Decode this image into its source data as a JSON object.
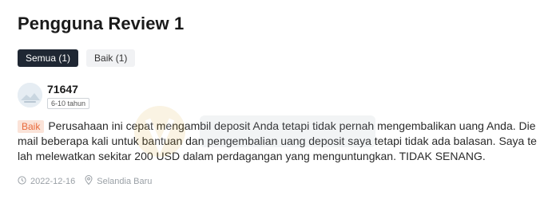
{
  "header": {
    "title": "Pengguna Review 1"
  },
  "tabs": [
    {
      "label": "Semua (1)",
      "active": true
    },
    {
      "label": "Baik (1)",
      "active": false
    }
  ],
  "review": {
    "user": {
      "name": "71647",
      "badge": "6-10 tahun",
      "avatar_icon": "user-avatar-icon"
    },
    "rating_label": "Baik",
    "text": "Perusahaan ini cepat mengambil deposit Anda tetapi tidak pernah mengembalikan uang Anda. Die mail beberapa kali untuk bantuan dan pengembalian uang deposit saya tetapi tidak ada balasan. Saya telah melewatkan sekitar 200 USD dalam perdagangan yang menguntungkan. TIDAK SENANG.",
    "date": "2022-12-16",
    "location": "Selandia Baru"
  },
  "colors": {
    "tab_active_bg": "#1f2733",
    "rating_tag_bg": "#fbe3d8",
    "rating_tag_text": "#e86a3c",
    "meta_text": "#9aa0a6"
  }
}
